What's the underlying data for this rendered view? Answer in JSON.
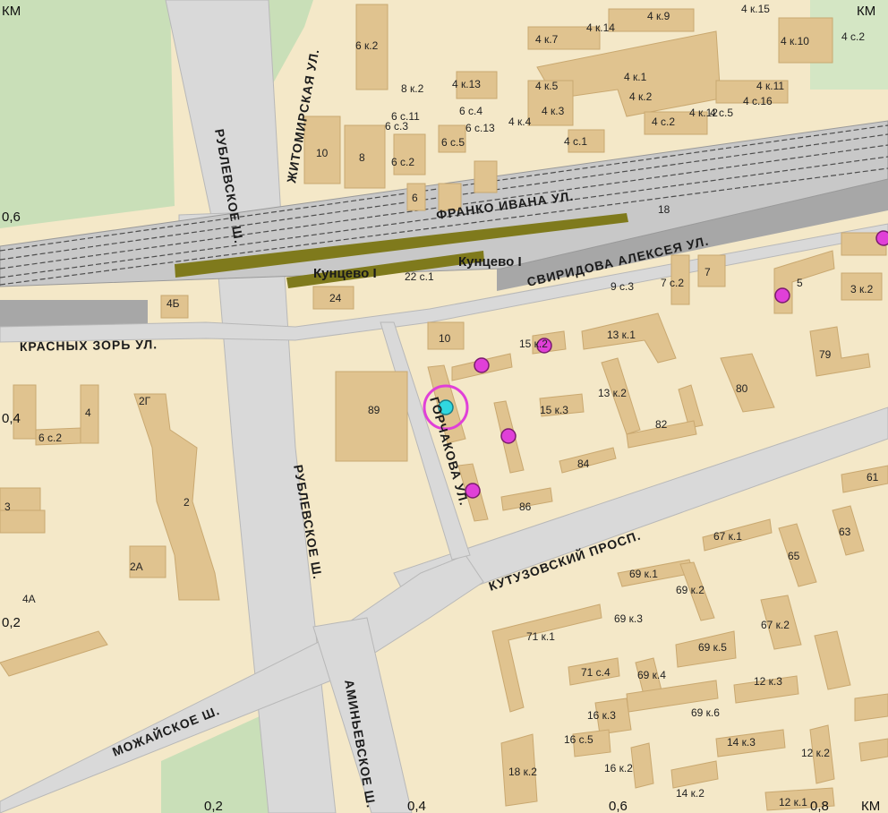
{
  "axis_labels": {
    "top_left": "КМ",
    "top_right": "КМ",
    "bottom_right": "КМ",
    "left_06": "0,6",
    "left_04": "0,4",
    "left_02": "0,2",
    "bottom_02": "0,2",
    "bottom_04": "0,4",
    "bottom_06": "0,6",
    "bottom_08": "0,8"
  },
  "streets": {
    "zhitomirskaya": "ЖИТОМИРСКАЯ УЛ.",
    "rublevskoe_1": "РУБЛЕВСКОЕ Ш.",
    "rublevskoe_2": "РУБЛЕВСКОЕ Ш.",
    "franko": "ФРАНКО ИВАНА УЛ.",
    "sviridova": "СВИРИДОВА АЛЕКСЕЯ УЛ.",
    "krasnykh_zor": "КРАСНЫХ ЗОРЬ УЛ.",
    "gorchakova": "ГОРЧАКОВА УЛ.",
    "kutuzovsky": "КУТУЗОВСКИЙ ПРОСП.",
    "mozhayskoe": "МОЖАЙСКОЕ Ш.",
    "aminevskoe": "АМИНЬЕВСКОЕ Ш."
  },
  "stations": {
    "kuntsevo_a": "Кунцево I",
    "kuntsevo_b": "Кунцево I"
  },
  "buildings": [
    "6 к.2",
    "8 к.2",
    "4 к.13",
    "4 к.7",
    "4 к.14",
    "4 к.9",
    "4 к.15",
    "4 к.10",
    "4 с.2",
    "4 к.5",
    "4 к.1",
    "4 к.2",
    "4 к.3",
    "4 к.4",
    "4 с.2",
    "4 к.12",
    "4 с.5",
    "4 к.11",
    "4 с.16",
    "6 с.4",
    "6 с.11",
    "6 с.3",
    "6 с.13",
    "6 с.5",
    "6 с.2",
    "4 с.1",
    "10",
    "8",
    "6",
    "22 с.1",
    "24",
    "4Б",
    "18",
    "7",
    "7 с.2",
    "9 с.3",
    "5",
    "3 к.2",
    "10",
    "15 к.2",
    "13 к.1",
    "79",
    "13 к.2",
    "80",
    "89",
    "15 к.3",
    "82",
    "84",
    "86",
    "2Г",
    "4",
    "6 с.2",
    "2",
    "2А",
    "4А",
    "3",
    "61",
    "67 к.1",
    "63",
    "65",
    "69 к.1",
    "69 к.2",
    "69 к.3",
    "67 к.2",
    "71 к.1",
    "71 с.4",
    "69 к.5",
    "69 к.4",
    "69 к.6",
    "12 к.3",
    "16 к.3",
    "16 с.5",
    "16 к.2",
    "14 к.3",
    "12 к.2",
    "18 к.2",
    "14 к.2",
    "12 к.1"
  ],
  "colors": {
    "background": "#f4e8c8",
    "building": "#e0c38f",
    "park": "#c9dfb8",
    "road": "#d9d9d9",
    "rail_platform": "#7f7a1c",
    "poi_magenta": "#e040d8",
    "poi_current": "#30d8e0"
  }
}
